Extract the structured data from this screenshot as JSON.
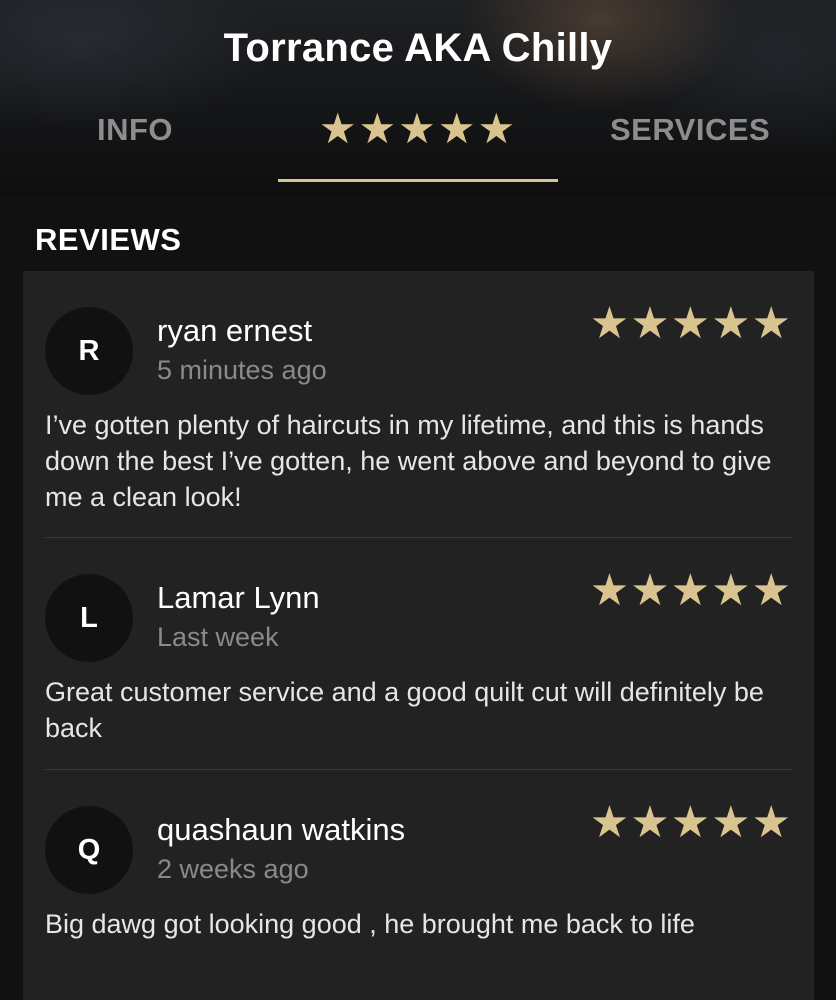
{
  "header": {
    "title": "Torrance AKA Chilly",
    "tabs": {
      "info": "INFO",
      "reviews_stars": "★★★★★",
      "services": "SERVICES"
    },
    "active_tab": "reviews",
    "accent_color": "#d9c48f"
  },
  "reviews_section": {
    "title": "REVIEWS",
    "reviews": [
      {
        "initial": "R",
        "name": "ryan ernest",
        "time": "5 minutes ago",
        "stars": "★★★★★",
        "rating": 5,
        "text": "I’ve gotten plenty of haircuts in my lifetime, and this is hands down the best I’ve gotten, he went above and beyond to give me a clean look!"
      },
      {
        "initial": "L",
        "name": "Lamar Lynn",
        "time": "Last week",
        "stars": "★★★★★",
        "rating": 5,
        "text": "Great customer service and a good quilt cut will definitely be back"
      },
      {
        "initial": "Q",
        "name": "quashaun watkins",
        "time": "2 weeks ago",
        "stars": "★★★★★",
        "rating": 5,
        "text": "Big dawg got looking good , he brought me back to life"
      }
    ]
  }
}
